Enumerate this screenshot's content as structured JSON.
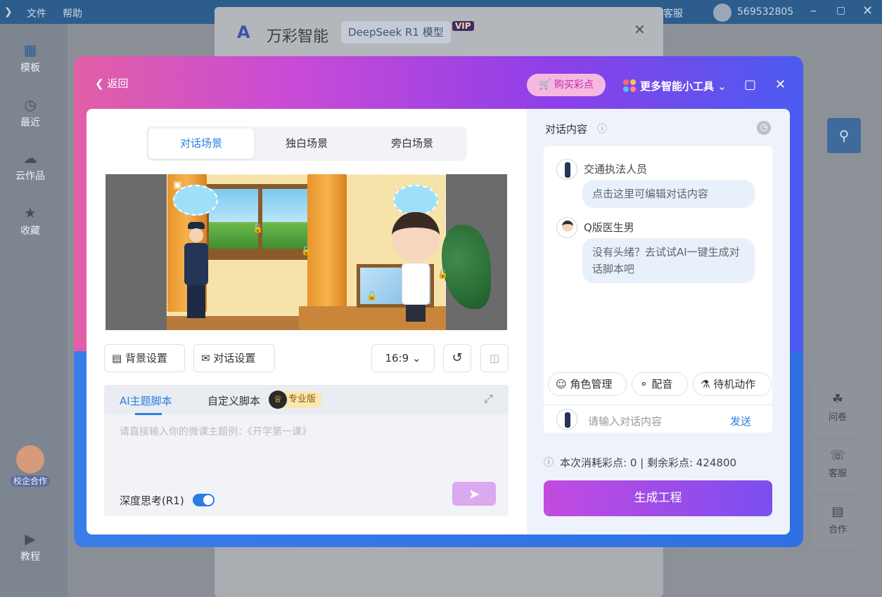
{
  "background": {
    "menu": [
      "文件",
      "帮助"
    ],
    "support_label": "客服",
    "user_id": "569532805",
    "nav": [
      {
        "label": "模板",
        "icon": "grid-icon"
      },
      {
        "label": "最近",
        "icon": "clock-icon"
      },
      {
        "label": "云作品",
        "icon": "cloud-icon"
      },
      {
        "label": "收藏",
        "icon": "star-icon"
      },
      {
        "label": "校企合作",
        "icon": "person-icon"
      },
      {
        "label": "教程",
        "icon": "play-icon"
      }
    ],
    "window_brand": "万彩智能",
    "window_model": "DeepSeek R1 模型",
    "window_vip": "VIP",
    "right_tools": [
      {
        "label": "问卷",
        "icon": "handshake-icon"
      },
      {
        "label": "客服",
        "icon": "headset-icon"
      },
      {
        "label": "合作",
        "icon": "clipboard-icon"
      }
    ]
  },
  "dialog": {
    "back_label": "返回",
    "buy_label": "购买彩点",
    "tools_label": "更多智能小工具",
    "tabs": [
      "对话场景",
      "独白场景",
      "旁白场景"
    ],
    "active_tab": 0,
    "toolbar": {
      "background_settings": "背景设置",
      "dialog_settings": "对话设置",
      "aspect_ratio": "16:9"
    },
    "script": {
      "tab_ai": "AI主题脚本",
      "tab_custom": "自定义脚本",
      "pro_badge": "专业版",
      "placeholder": "请直接输入你的微课主题例：《开学第一课》",
      "deep_think_label": "深度思考(R1)",
      "deep_think_on": true
    },
    "chat": {
      "title": "对话内容",
      "messages": [
        {
          "speaker": "交通执法人员",
          "text": "点击这里可编辑对话内容"
        },
        {
          "speaker": "Q版医生男",
          "text": "没有头绪？去试试AI一键生成对话脚本吧"
        }
      ],
      "chips": [
        "角色管理",
        "配音",
        "待机动作"
      ],
      "input_placeholder": "请输入对话内容",
      "send_label": "发送"
    },
    "cost_text": "本次消耗彩点: 0 | 剩余彩点: 424800",
    "generate_label": "生成工程"
  }
}
